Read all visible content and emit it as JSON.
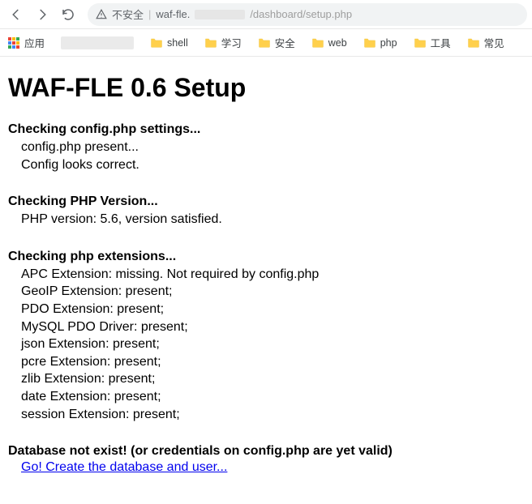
{
  "chrome": {
    "security_text": "不安全",
    "url_prefix": "waf-fle.",
    "url_suffix": "/dashboard/setup.php"
  },
  "bookmarks": {
    "apps_label": "应用",
    "items": [
      {
        "label": "shell"
      },
      {
        "label": "学习"
      },
      {
        "label": "安全"
      },
      {
        "label": "web"
      },
      {
        "label": "php"
      },
      {
        "label": "工具"
      },
      {
        "label": "常见"
      }
    ]
  },
  "page": {
    "title": "WAF-FLE 0.6 Setup",
    "sections": [
      {
        "title": "Checking config.php settings...",
        "lines": [
          "config.php present...",
          "Config looks correct."
        ]
      },
      {
        "title": "Checking PHP Version...",
        "lines": [
          "PHP version: 5.6, version satisfied."
        ]
      },
      {
        "title": "Checking php extensions...",
        "lines": [
          "APC Extension: missing. Not required by config.php",
          "GeoIP Extension: present;",
          "PDO Extension: present;",
          "MySQL PDO Driver: present;",
          "json Extension: present;",
          "pcre Extension: present;",
          "zlib Extension: present;",
          "date Extension: present;",
          "session Extension: present;"
        ]
      }
    ],
    "db_error": "Database not exist! (or credentials on config.php are yet valid)",
    "db_link": "Go! Create the database and user..."
  }
}
